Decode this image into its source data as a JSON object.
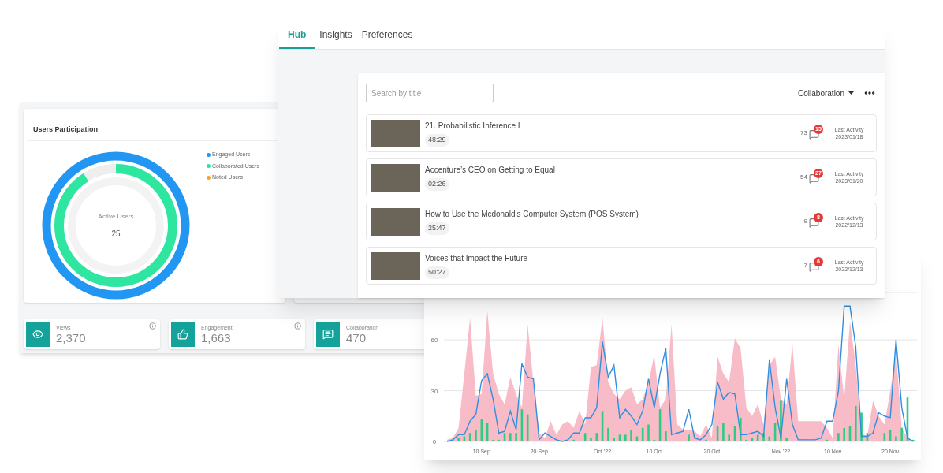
{
  "dashboard": {
    "participation": {
      "title": "Users Participation",
      "legend": [
        {
          "label": "Engaged Users",
          "color": "#2196f3"
        },
        {
          "label": "Collaborated Users",
          "color": "#2ee6a0"
        },
        {
          "label": "Noted Users",
          "color": "#f5a623"
        }
      ],
      "center_label": "Active Users",
      "center_value": "25"
    },
    "stats": [
      {
        "kind": "views",
        "label": "Views",
        "value": "2,370",
        "info": true
      },
      {
        "kind": "engagement",
        "label": "Engagement",
        "value": "1,663",
        "info": true
      },
      {
        "kind": "collaboration",
        "label": "Collaboration",
        "value": "470",
        "info": false
      }
    ]
  },
  "hub": {
    "tabs": [
      {
        "label": "Hub",
        "selected": true
      },
      {
        "label": "Insights",
        "selected": false
      },
      {
        "label": "Preferences",
        "selected": false
      }
    ],
    "search": {
      "placeholder": "Search by title"
    },
    "filter": "Collaboration",
    "videos": [
      {
        "title": "21. Probabilistic Inference I",
        "duration": "48:29",
        "count": "73",
        "badge": "15",
        "activity_label": "Last Activity",
        "date": "2023/01/18"
      },
      {
        "title": "Accenture’s CEO on Getting to Equal",
        "duration": "02:26",
        "count": "54",
        "badge": "27",
        "activity_label": "Last Activity",
        "date": "2023/01/20"
      },
      {
        "title": "How to Use the Mcdonald's Computer System (POS System)",
        "duration": "25:47",
        "count": "9",
        "badge": "8",
        "activity_label": "Last Activity",
        "date": "2022/12/13"
      },
      {
        "title": "Voices that Impact the Future",
        "duration": "50:27",
        "count": "7",
        "badge": "6",
        "activity_label": "Last Activity",
        "date": "2022/12/13"
      }
    ]
  },
  "activity": {
    "chart_data": {
      "type": "area",
      "categories": [
        null,
        null,
        null,
        null,
        null,
        null,
        "10 Sep",
        null,
        null,
        null,
        null,
        null,
        null,
        null,
        null,
        null,
        "20 Sep",
        null,
        null,
        null,
        null,
        null,
        null,
        null,
        null,
        null,
        null,
        "Oct '22",
        null,
        null,
        null,
        null,
        null,
        null,
        null,
        null,
        "10 Oct",
        null,
        null,
        null,
        null,
        null,
        null,
        null,
        null,
        null,
        "20 Oct",
        null,
        null,
        null,
        null,
        null,
        null,
        null,
        null,
        null,
        null,
        null,
        "Nov '22",
        null,
        null,
        null,
        null,
        null,
        null,
        null,
        null,
        "10 Nov",
        null,
        null,
        null,
        null,
        null,
        null,
        null,
        null,
        null,
        "20 Nov",
        null,
        null,
        null,
        null
      ],
      "ylim": [
        0,
        88
      ],
      "yticks": [
        0,
        30,
        60
      ],
      "series": [
        {
          "type": "area",
          "color": "#f8bcc8",
          "values": [
            1,
            2,
            8,
            40,
            73,
            27,
            28,
            77,
            40,
            28,
            22,
            38,
            28,
            20,
            69,
            35,
            5,
            2,
            12,
            4,
            10,
            12,
            8,
            18,
            10,
            44,
            45,
            73,
            35,
            28,
            25,
            30,
            32,
            22,
            25,
            35,
            51,
            20,
            25,
            69,
            10,
            7,
            7,
            6,
            3,
            10,
            2,
            50,
            40,
            35,
            61,
            55,
            20,
            15,
            22,
            10,
            45,
            50,
            25,
            22,
            58,
            12,
            12,
            12,
            12,
            12,
            8,
            2,
            57,
            25,
            71,
            45,
            5,
            3,
            24,
            15,
            10,
            30,
            53,
            8,
            2,
            0
          ]
        },
        {
          "type": "line",
          "color": "#2f8fe0",
          "values": [
            0,
            1,
            4,
            4,
            12,
            16,
            36,
            40,
            25,
            5,
            6,
            18,
            7,
            46,
            38,
            37,
            1,
            5,
            3,
            1,
            0,
            1,
            5,
            5,
            14,
            14,
            20,
            59,
            38,
            45,
            14,
            19,
            15,
            10,
            18,
            37,
            20,
            40,
            55,
            4,
            5,
            6,
            19,
            2,
            1,
            4,
            10,
            35,
            25,
            29,
            28,
            4,
            4,
            5,
            6,
            3,
            48,
            20,
            2,
            37,
            10,
            1,
            1,
            1,
            1,
            2,
            12,
            12,
            30,
            80,
            80,
            56,
            3,
            3,
            5,
            17,
            15,
            14,
            60,
            20,
            2,
            0
          ]
        },
        {
          "type": "bar",
          "color": "#2ecc80",
          "values": [
            0,
            1,
            2,
            3,
            5,
            7,
            13,
            11,
            1,
            1,
            5,
            5,
            5,
            19,
            16,
            0,
            0,
            0,
            0,
            0,
            0,
            0,
            1,
            0,
            5,
            2,
            5,
            18,
            8,
            2,
            4,
            4,
            7,
            3,
            8,
            10,
            1,
            19,
            6,
            0,
            0,
            0,
            4,
            0,
            0,
            1,
            0,
            9,
            11,
            4,
            9,
            14,
            1,
            2,
            4,
            5,
            3,
            11,
            24,
            2,
            0,
            0,
            0,
            0,
            0,
            0,
            1,
            0,
            5,
            8,
            9,
            21,
            17,
            5,
            0,
            0,
            5,
            7,
            3,
            8,
            26,
            1
          ]
        }
      ]
    }
  }
}
